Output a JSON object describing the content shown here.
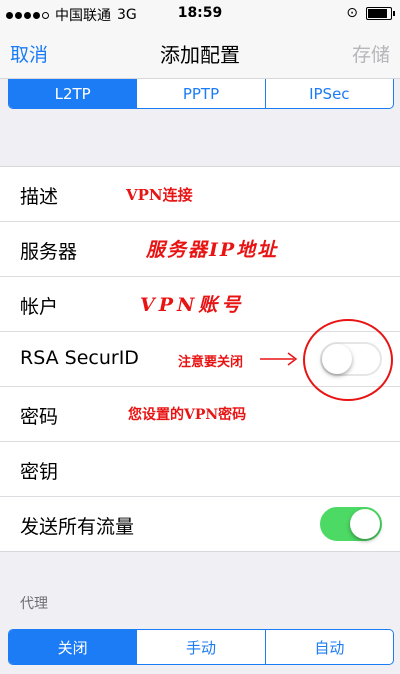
{
  "status": {
    "carrier": "中国联通",
    "network": "3G",
    "time": "18:59"
  },
  "nav": {
    "cancel": "取消",
    "title": "添加配置",
    "save": "存储"
  },
  "vpn_types": [
    "L2TP",
    "PPTP",
    "IPSec"
  ],
  "vpn_type_selected": "L2TP",
  "fields": {
    "description": "描述",
    "server": "服务器",
    "account": "帐户",
    "rsa": "RSA SecurID",
    "password": "密码",
    "secret": "密钥",
    "send_all_traffic": "发送所有流量"
  },
  "toggles": {
    "rsa_on": false,
    "send_all_traffic_on": true
  },
  "annotations": {
    "description_note": "VPN连接",
    "server_note": "服务器IP地址",
    "account_note": "VPN账号",
    "rsa_note": "注意要关闭",
    "password_note": "您设置的VPN密码"
  },
  "proxy": {
    "header": "代理",
    "options": [
      "关闭",
      "手动",
      "自动"
    ],
    "selected": "关闭"
  },
  "colors": {
    "accent": "#1b7cf5",
    "annotation": "#e81414",
    "toggle_on": "#4cd964"
  }
}
